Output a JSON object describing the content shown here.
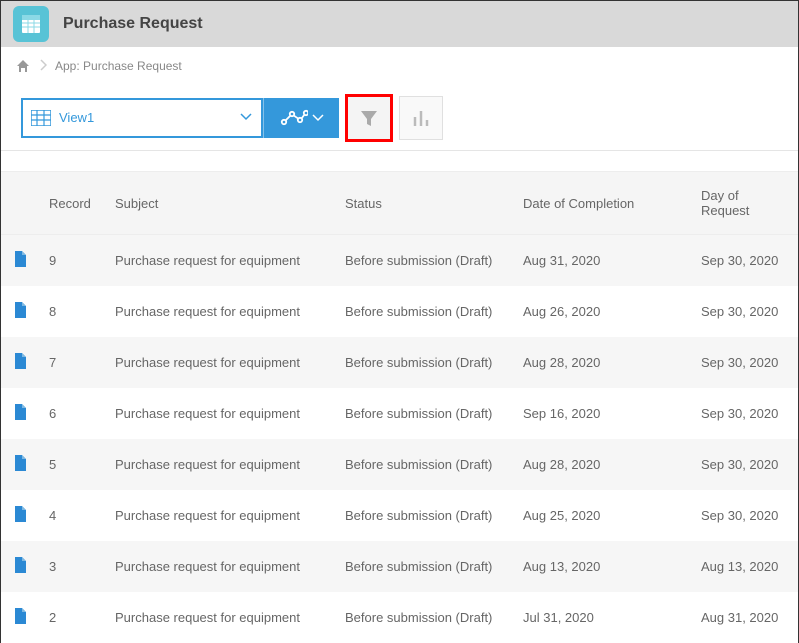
{
  "header": {
    "title": "Purchase Request"
  },
  "breadcrumb": {
    "app_label": "App: Purchase Request"
  },
  "toolbar": {
    "view_label": "View1"
  },
  "table": {
    "columns": {
      "record": "Record",
      "subject": "Subject",
      "status": "Status",
      "completion": "Date of Completion",
      "request": "Day of Request"
    },
    "rows": [
      {
        "record": "9",
        "subject": "Purchase request for equipment",
        "status": "Before submission (Draft)",
        "completion": "Aug 31, 2020",
        "request": "Sep 30, 2020"
      },
      {
        "record": "8",
        "subject": "Purchase request for equipment",
        "status": "Before submission (Draft)",
        "completion": "Aug 26, 2020",
        "request": "Sep 30, 2020"
      },
      {
        "record": "7",
        "subject": "Purchase request for equipment",
        "status": "Before submission (Draft)",
        "completion": "Aug 28, 2020",
        "request": "Sep 30, 2020"
      },
      {
        "record": "6",
        "subject": "Purchase request for equipment",
        "status": "Before submission (Draft)",
        "completion": "Sep 16, 2020",
        "request": "Sep 30, 2020"
      },
      {
        "record": "5",
        "subject": "Purchase request for equipment",
        "status": "Before submission (Draft)",
        "completion": "Aug 28, 2020",
        "request": "Sep 30, 2020"
      },
      {
        "record": "4",
        "subject": "Purchase request for equipment",
        "status": "Before submission (Draft)",
        "completion": "Aug 25, 2020",
        "request": "Sep 30, 2020"
      },
      {
        "record": "3",
        "subject": "Purchase request for equipment",
        "status": "Before submission (Draft)",
        "completion": "Aug 13, 2020",
        "request": "Aug 13, 2020"
      },
      {
        "record": "2",
        "subject": "Purchase request for equipment",
        "status": "Before submission (Draft)",
        "completion": "Jul 31, 2020",
        "request": "Aug 31, 2020"
      }
    ]
  }
}
